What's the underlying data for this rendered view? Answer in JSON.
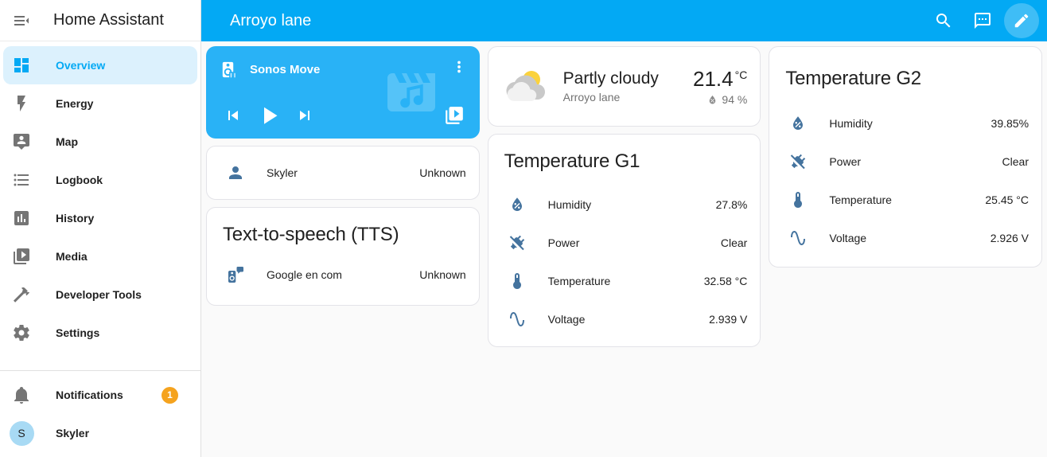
{
  "sidebar": {
    "title": "Home Assistant",
    "items": [
      {
        "label": "Overview",
        "icon": "view-dashboard-icon"
      },
      {
        "label": "Energy",
        "icon": "lightning-bolt-icon"
      },
      {
        "label": "Map",
        "icon": "tooltip-account-icon"
      },
      {
        "label": "Logbook",
        "icon": "format-list-bulleted-icon"
      },
      {
        "label": "History",
        "icon": "chart-box-icon"
      },
      {
        "label": "Media",
        "icon": "play-box-multiple-icon"
      },
      {
        "label": "Developer Tools",
        "icon": "hammer-icon"
      },
      {
        "label": "Settings",
        "icon": "cog-icon"
      }
    ],
    "notifications": {
      "label": "Notifications",
      "badge": "1",
      "icon": "bell-icon"
    },
    "profile": {
      "name": "Skyler",
      "initial": "S"
    }
  },
  "header": {
    "title": "Arroyo lane",
    "icons": [
      "search-icon",
      "assist-chat-icon",
      "edit-pencil-icon"
    ]
  },
  "media_card": {
    "name": "Sonos Move",
    "icons": [
      "speaker-pause-icon",
      "dots-vertical-icon",
      "skip-previous-icon",
      "play-icon",
      "skip-next-icon",
      "browse-media-icon",
      "movie-music-watermark-icon"
    ]
  },
  "person_card": {
    "name": "Skyler",
    "state": "Unknown",
    "icon": "account-icon"
  },
  "tts_card": {
    "title": "Text-to-speech (TTS)",
    "entity": {
      "name": "Google en com",
      "state": "Unknown",
      "icon": "speaker-message-icon"
    }
  },
  "weather_card": {
    "condition": "Partly cloudy",
    "location": "Arroyo lane",
    "temperature": "21.4",
    "temperature_unit": "°C",
    "humidity": "94 %",
    "icons": [
      "partly-cloudy-icon",
      "water-percent-icon"
    ]
  },
  "temp_g1_card": {
    "title": "Temperature G1",
    "rows": [
      {
        "icon": "water-percent-icon",
        "label": "Humidity",
        "value": "27.8%"
      },
      {
        "icon": "power-plug-off-icon",
        "label": "Power",
        "value": "Clear"
      },
      {
        "icon": "thermometer-icon",
        "label": "Temperature",
        "value": "32.58 °C"
      },
      {
        "icon": "sine-wave-icon",
        "label": "Voltage",
        "value": "2.939 V"
      }
    ]
  },
  "temp_g2_card": {
    "title": "Temperature G2",
    "rows": [
      {
        "icon": "water-percent-icon",
        "label": "Humidity",
        "value": "39.85%"
      },
      {
        "icon": "power-plug-off-icon",
        "label": "Power",
        "value": "Clear"
      },
      {
        "icon": "thermometer-icon",
        "label": "Temperature",
        "value": "25.45 °C"
      },
      {
        "icon": "sine-wave-icon",
        "label": "Voltage",
        "value": "2.926 V"
      }
    ]
  },
  "colors": {
    "primary": "#03a9f4",
    "media_card_bg": "#29b2f6",
    "badge_orange": "#f5a31e",
    "entity_icon_blue": "#44739e",
    "active_item_bg": "#dcf1fd"
  }
}
